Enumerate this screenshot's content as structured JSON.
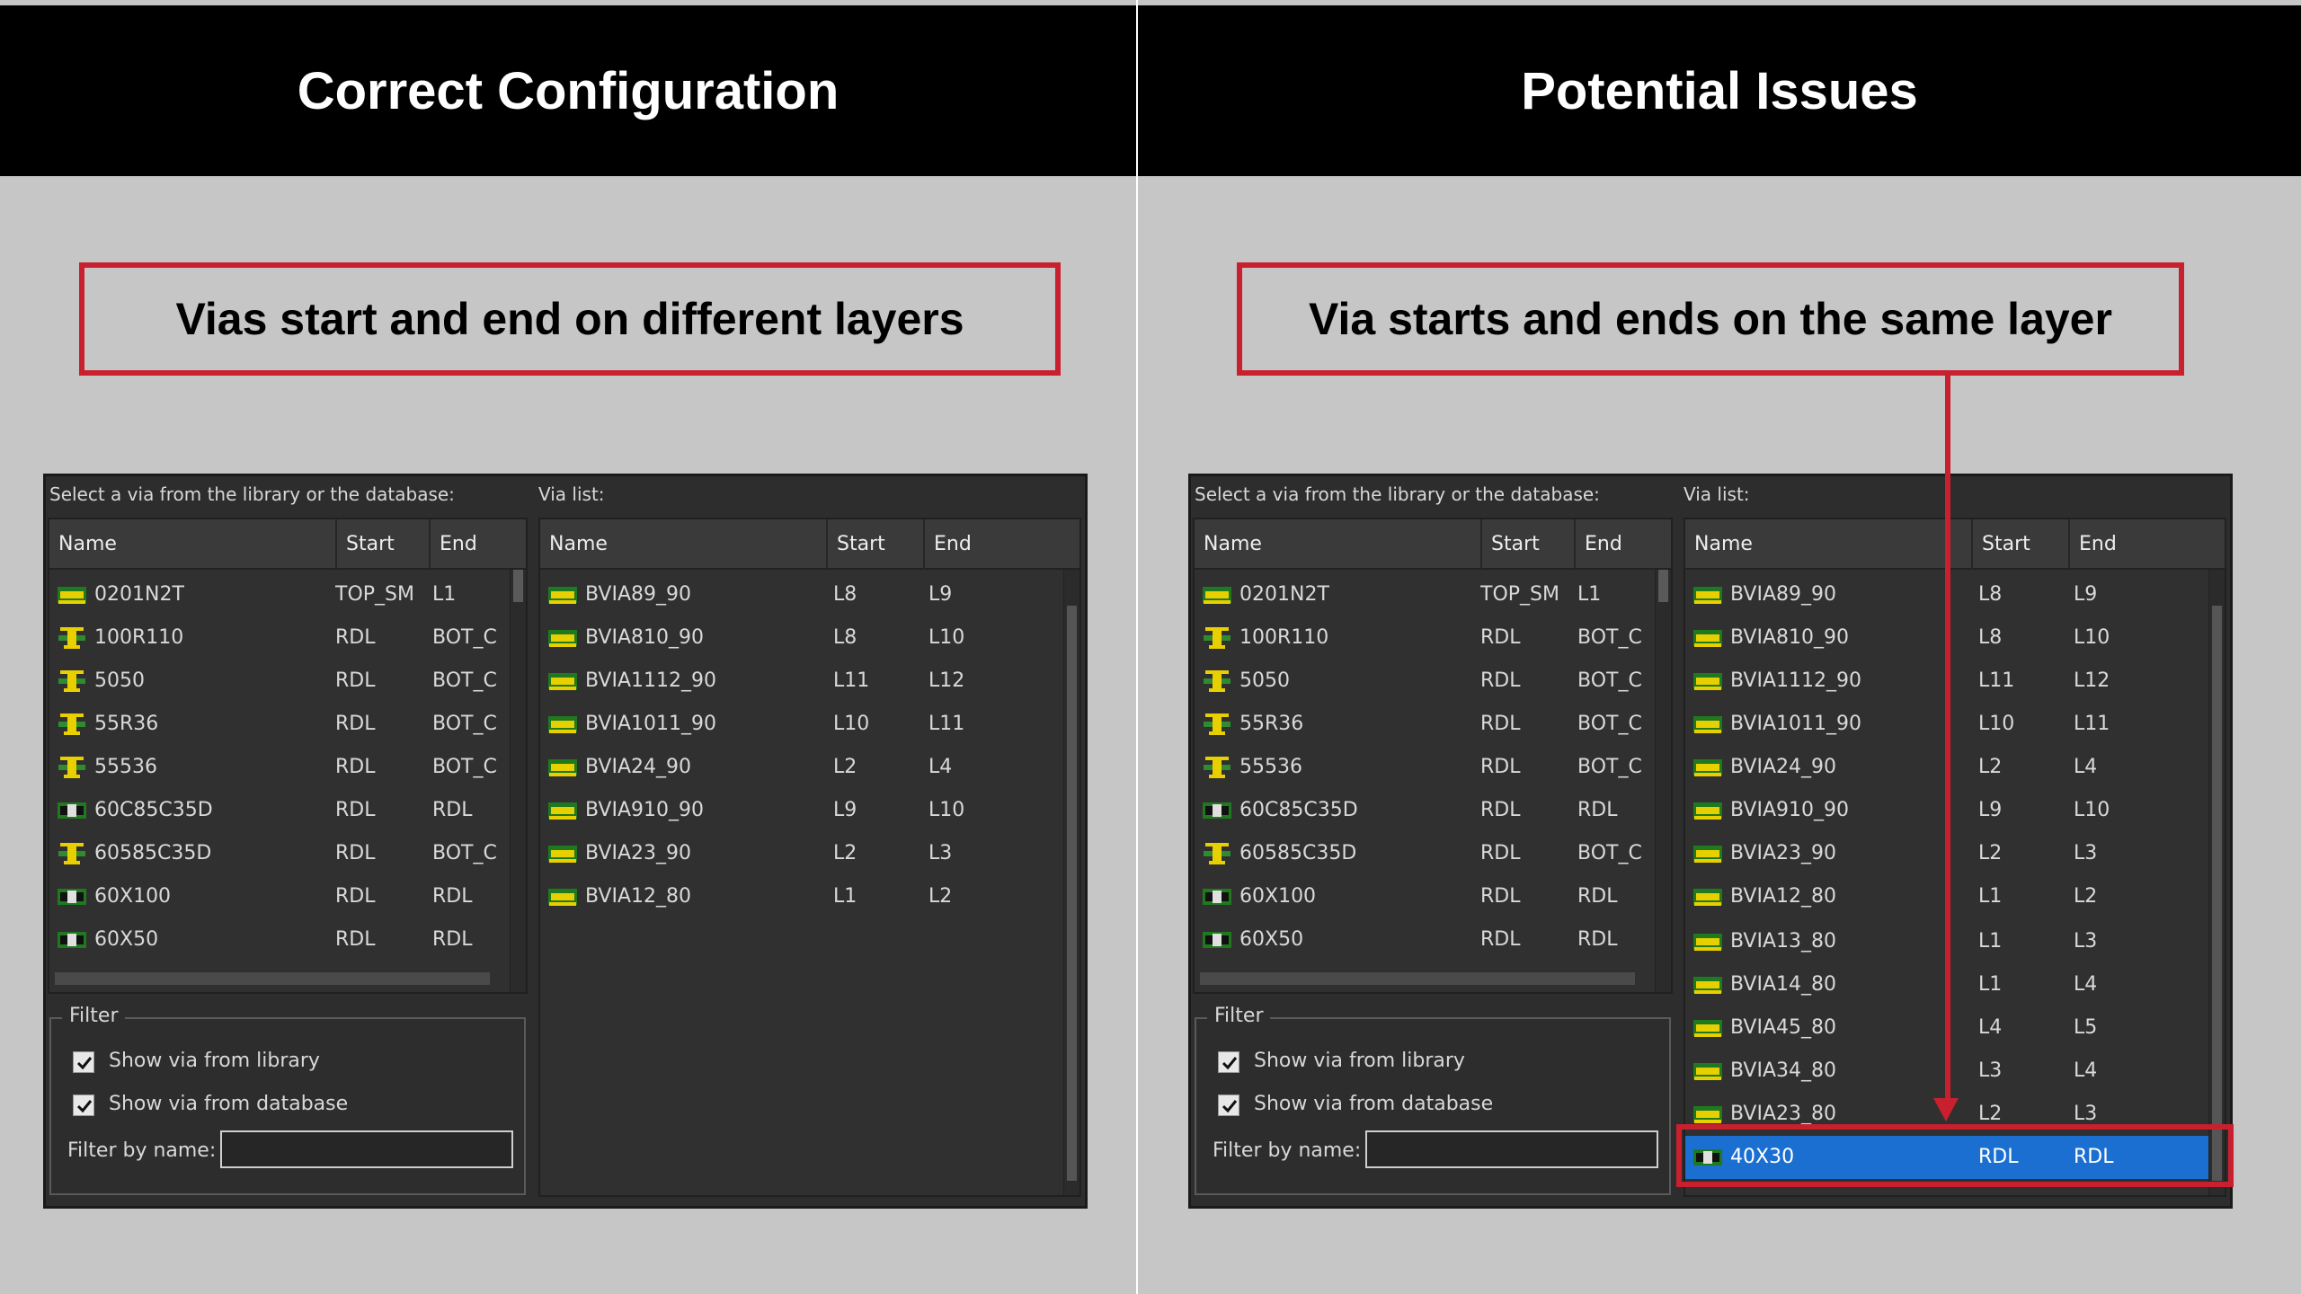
{
  "left_panel": {
    "title": "Correct Configuration",
    "callout": "Vias start and end on different layers"
  },
  "right_panel": {
    "title": "Potential Issues",
    "callout": "Via starts and ends on the same layer"
  },
  "dialog": {
    "library_label": "Select a via from the library or the database:",
    "vialist_label": "Via list:",
    "columns": {
      "name": "Name",
      "start": "Start",
      "end": "End"
    },
    "filter": {
      "title": "Filter",
      "show_library": "Show via from library",
      "show_database": "Show via from database",
      "filter_by_name": "Filter by name:",
      "filter_value": ""
    }
  },
  "library_rows": [
    {
      "name": "0201N2T",
      "start": "TOP_SM",
      "end": "L1",
      "icon": "via-green-icon"
    },
    {
      "name": "100R110",
      "start": "RDL",
      "end": "BOT_C",
      "icon": "via-yellow-icon"
    },
    {
      "name": "5050",
      "start": "RDL",
      "end": "BOT_C",
      "icon": "via-yellow-icon"
    },
    {
      "name": "55R36",
      "start": "RDL",
      "end": "BOT_C",
      "icon": "via-yellow-icon"
    },
    {
      "name": "55536",
      "start": "RDL",
      "end": "BOT_C",
      "icon": "via-yellow-icon"
    },
    {
      "name": "60C85C35D",
      "start": "RDL",
      "end": "RDL",
      "icon": "via-pad-icon"
    },
    {
      "name": "60585C35D",
      "start": "RDL",
      "end": "BOT_C",
      "icon": "via-yellow-icon"
    },
    {
      "name": "60X100",
      "start": "RDL",
      "end": "RDL",
      "icon": "via-pad-icon"
    },
    {
      "name": "60X50",
      "start": "RDL",
      "end": "RDL",
      "icon": "via-pad-icon"
    }
  ],
  "left_vialist": [
    {
      "name": "BVIA89_90",
      "start": "L8",
      "end": "L9"
    },
    {
      "name": "BVIA810_90",
      "start": "L8",
      "end": "L10"
    },
    {
      "name": "BVIA1112_90",
      "start": "L11",
      "end": "L12"
    },
    {
      "name": "BVIA1011_90",
      "start": "L10",
      "end": "L11"
    },
    {
      "name": "BVIA24_90",
      "start": "L2",
      "end": "L4"
    },
    {
      "name": "BVIA910_90",
      "start": "L9",
      "end": "L10"
    },
    {
      "name": "BVIA23_90",
      "start": "L2",
      "end": "L3"
    },
    {
      "name": "BVIA12_80",
      "start": "L1",
      "end": "L2"
    }
  ],
  "right_vialist": [
    {
      "name": "BVIA89_90",
      "start": "L8",
      "end": "L9"
    },
    {
      "name": "BVIA810_90",
      "start": "L8",
      "end": "L10"
    },
    {
      "name": "BVIA1112_90",
      "start": "L11",
      "end": "L12"
    },
    {
      "name": "BVIA1011_90",
      "start": "L10",
      "end": "L11"
    },
    {
      "name": "BVIA24_90",
      "start": "L2",
      "end": "L4"
    },
    {
      "name": "BVIA910_90",
      "start": "L9",
      "end": "L10"
    },
    {
      "name": "BVIA23_90",
      "start": "L2",
      "end": "L3"
    },
    {
      "name": "BVIA12_80",
      "start": "L1",
      "end": "L2"
    },
    {
      "name": "BVIA13_80",
      "start": "L1",
      "end": "L3"
    },
    {
      "name": "BVIA14_80",
      "start": "L1",
      "end": "L4"
    },
    {
      "name": "BVIA45_80",
      "start": "L4",
      "end": "L5"
    },
    {
      "name": "BVIA34_80",
      "start": "L3",
      "end": "L4"
    },
    {
      "name": "BVIA23_80",
      "start": "L2",
      "end": "L3"
    },
    {
      "name": "40X30",
      "start": "RDL",
      "end": "RDL",
      "selected": true,
      "icon": "via-pad-icon"
    }
  ],
  "colors": {
    "highlight": "#c8202e",
    "selection": "#1b6fd0",
    "panel_bg": "#c6c6c6",
    "dialog_bg": "#2d2d2d"
  }
}
